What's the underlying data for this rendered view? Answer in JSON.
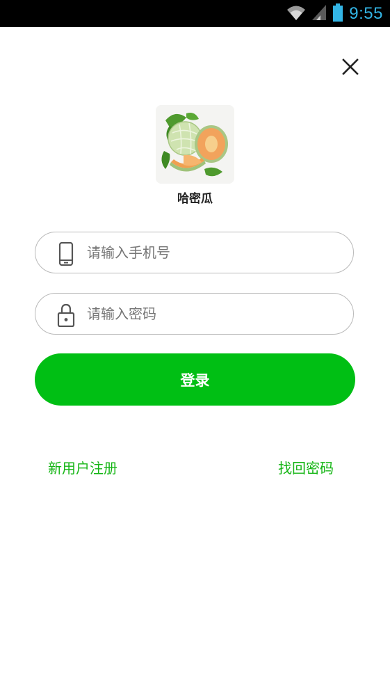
{
  "status_bar": {
    "time": "9:55",
    "icons": [
      "wifi-icon",
      "signal-icon",
      "battery-icon"
    ]
  },
  "header": {
    "close_icon": "close-icon"
  },
  "app": {
    "name": "哈密瓜",
    "logo": "melon-logo"
  },
  "form": {
    "phone": {
      "icon": "phone-icon",
      "placeholder": "请输入手机号",
      "value": ""
    },
    "password": {
      "icon": "lock-icon",
      "placeholder": "请输入密码",
      "value": ""
    },
    "login_label": "登录"
  },
  "links": {
    "register": "新用户注册",
    "forgot_password": "找回密码"
  },
  "colors": {
    "primary": "#00bf14",
    "link": "#14b514",
    "status_time": "#33b5e5",
    "field_border": "#b9b9b9"
  }
}
